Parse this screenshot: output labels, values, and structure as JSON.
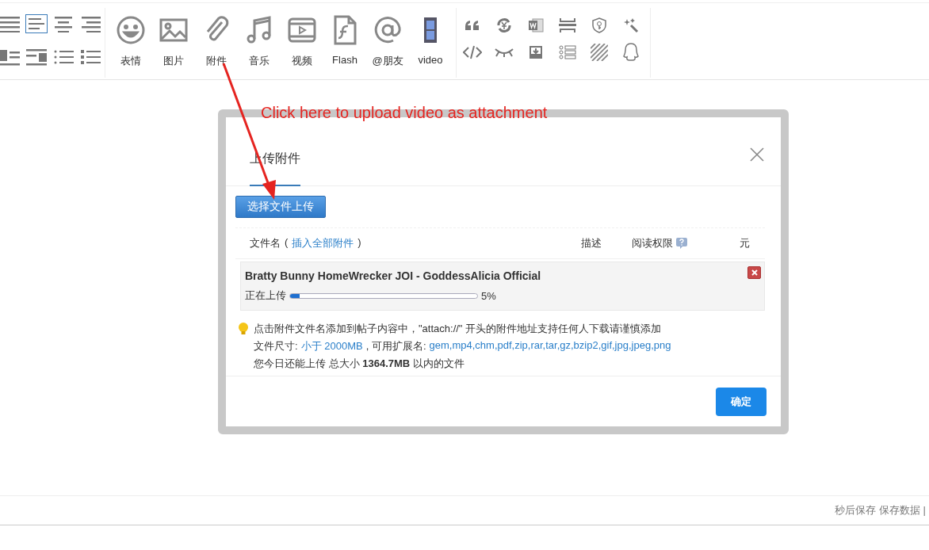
{
  "toolbar": {
    "align_buttons": [
      {
        "selected": false
      },
      {
        "selected": true
      },
      {
        "selected": false
      },
      {
        "selected": false
      },
      {
        "selected": false
      },
      {
        "selected": false
      },
      {
        "selected": false
      },
      {
        "selected": false
      }
    ],
    "insert_buttons": [
      {
        "label": "表情"
      },
      {
        "label": "图片"
      },
      {
        "label": "附件"
      },
      {
        "label": "音乐"
      },
      {
        "label": "视频"
      },
      {
        "label": "Flash"
      },
      {
        "label": "@朋友"
      },
      {
        "label": "video"
      }
    ]
  },
  "annotation": {
    "text": "Click here to upload video as attachment"
  },
  "dialog": {
    "title": "上传附件",
    "select_button": "选择文件上传",
    "header": {
      "file_name": "文件名",
      "open_paren": "(",
      "insert_all_link": "插入全部附件",
      "close_paren": ")",
      "description": "描述",
      "read_permission": "阅读权限",
      "price": "元"
    },
    "uploads": [
      {
        "name": "Bratty Bunny HomeWrecker JOI - GoddessAlicia Official",
        "status": "正在上传",
        "level": 0.05,
        "percent": "5%"
      }
    ],
    "tip": "点击附件文件名添加到帖子内容中，\"attach://\" 开头的附件地址支持任何人下载请谨慎添加",
    "size_label": "文件尺寸:",
    "size_limit": "小于 2000MB",
    "ext_label": ", 可用扩展名:",
    "extensions": "gem,mp4,chm,pdf,zip,rar,tar,gz,bzip2,gif,jpg,jpeg,png",
    "quota": "您今日还能上传 总大小 **1364.7MB** 以内的文件",
    "confirm_button": "确定"
  },
  "status_bar": {
    "text": "秒后保存 保存数据 |"
  }
}
